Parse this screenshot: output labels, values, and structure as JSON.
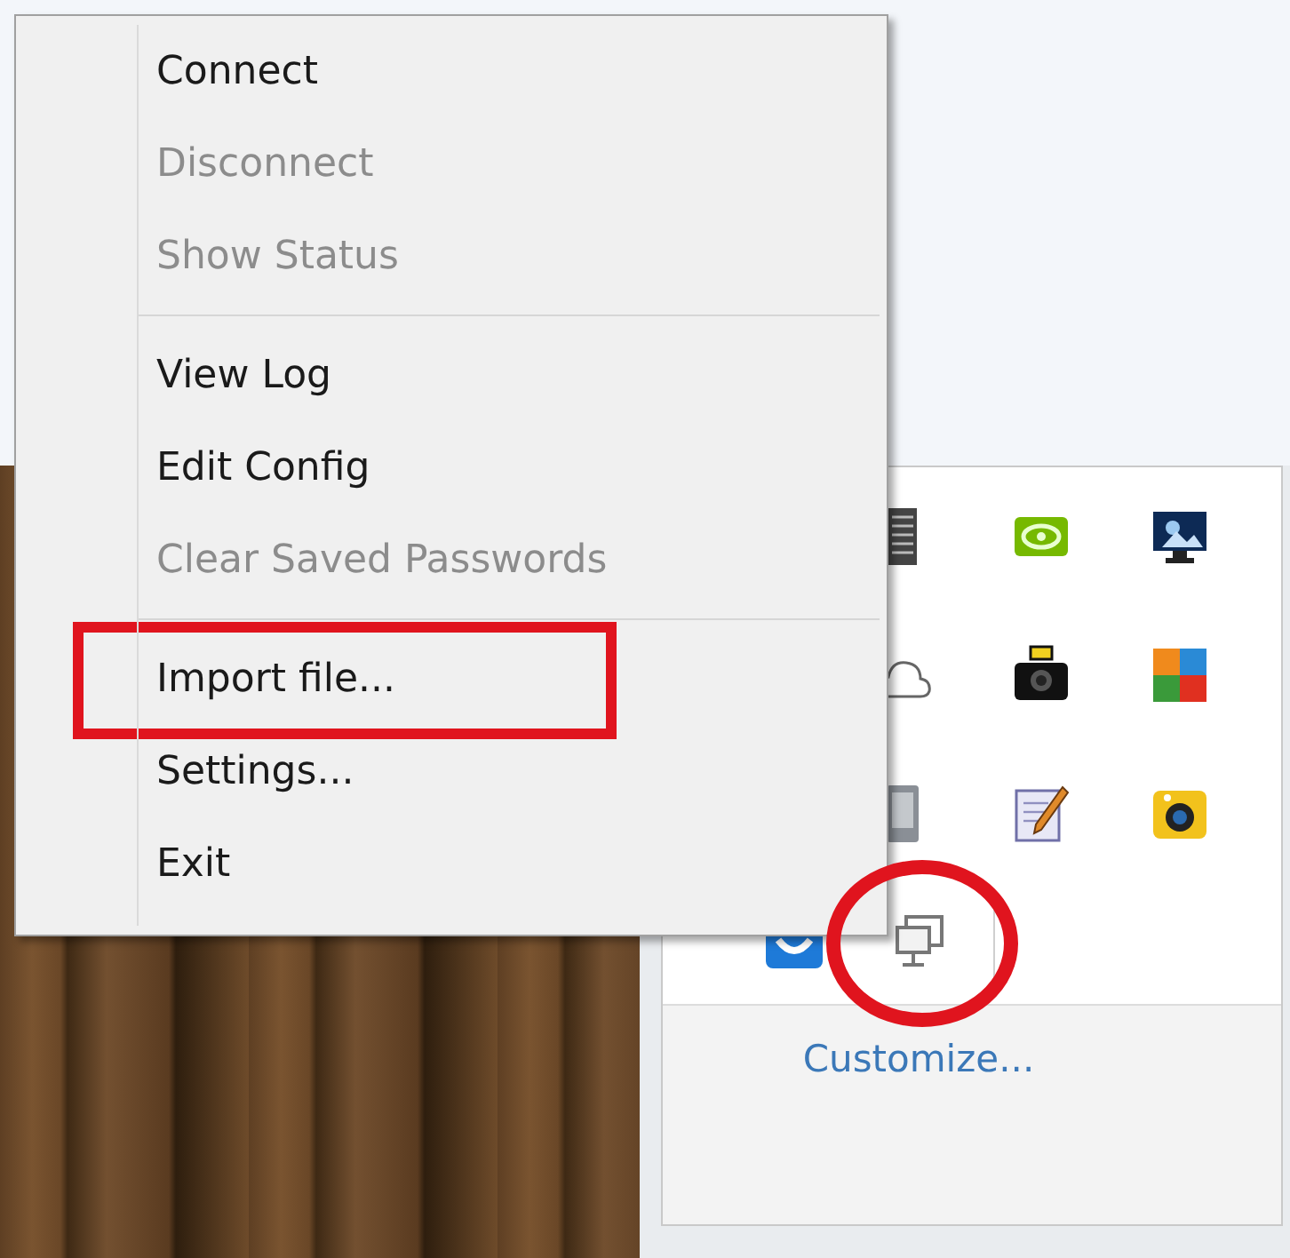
{
  "context_menu": {
    "sections": [
      {
        "items": [
          {
            "label": "Connect",
            "disabled": false,
            "annotated": false
          },
          {
            "label": "Disconnect",
            "disabled": true,
            "annotated": false
          },
          {
            "label": "Show Status",
            "disabled": true,
            "annotated": false
          }
        ]
      },
      {
        "items": [
          {
            "label": "View Log",
            "disabled": false,
            "annotated": false
          },
          {
            "label": "Edit Config",
            "disabled": false,
            "annotated": false
          },
          {
            "label": "Clear Saved Passwords",
            "disabled": true,
            "annotated": false
          }
        ]
      },
      {
        "items": [
          {
            "label": "Import file...",
            "disabled": false,
            "annotated": true
          },
          {
            "label": "Settings...",
            "disabled": false,
            "annotated": false
          },
          {
            "label": "Exit",
            "disabled": false,
            "annotated": false
          }
        ]
      }
    ]
  },
  "tray_flyout": {
    "overflow_icons": [
      [
        {
          "kind": "server",
          "annotated": false
        },
        {
          "kind": "eye",
          "annotated": false
        },
        {
          "kind": "monitor-photo",
          "annotated": false
        }
      ],
      [
        {
          "kind": "cloud",
          "annotated": false
        },
        {
          "kind": "camera",
          "annotated": false
        },
        {
          "kind": "tiles",
          "annotated": false
        }
      ],
      [
        {
          "kind": "phone",
          "annotated": false
        },
        {
          "kind": "notepad",
          "annotated": false
        },
        {
          "kind": "yellow-camera",
          "annotated": false
        }
      ]
    ],
    "pinned_icons": [
      {
        "kind": "blue-app",
        "annotated": false
      },
      {
        "kind": "monitor",
        "annotated": true
      }
    ],
    "customize_link": "Customize..."
  }
}
